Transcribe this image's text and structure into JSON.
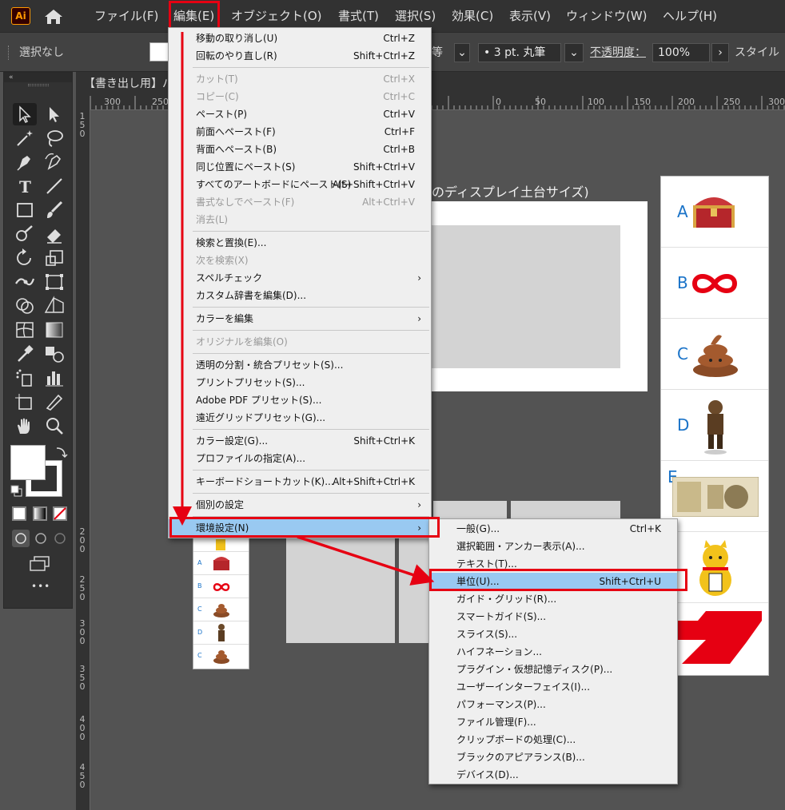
{
  "app": {
    "logo_text": "Ai"
  },
  "menubar": {
    "items": [
      "ファイル(F)",
      "編集(E)",
      "オブジェクト(O)",
      "書式(T)",
      "選択(S)",
      "効果(C)",
      "表示(V)",
      "ウィンドウ(W)",
      "ヘルプ(H)"
    ]
  },
  "controlbar": {
    "selection": "選択なし",
    "stroke_style": "等",
    "brush": "• 3 pt. 丸筆",
    "opacity_label": "不透明度：",
    "opacity_value": "100%",
    "style_label": "スタイル"
  },
  "toolbar": {
    "collapse": "«",
    "more": "•••"
  },
  "document": {
    "tab_title": "【書き出し用】パ",
    "artboard_title": "のディスプレイ土台サイズ)"
  },
  "rulers": {
    "h_ticks": [
      "300",
      "250",
      "150",
      "100",
      "50",
      "0",
      "50",
      "100",
      "150",
      "200",
      "250",
      "300"
    ],
    "v_ticks": [
      "1 5 0",
      "2 0 0",
      "2 5 0",
      "3 0 0",
      "3 5 0",
      "4 0 0",
      "4 5 0"
    ]
  },
  "stickers": {
    "letters": [
      "A",
      "B",
      "C",
      "D",
      "E"
    ],
    "mini_letters": [
      "A",
      "B",
      "C",
      "D",
      "C"
    ]
  },
  "edit_menu": {
    "items": [
      {
        "label": "移動の取り消し(U)",
        "shortcut": "Ctrl+Z"
      },
      {
        "label": "回転のやり直し(R)",
        "shortcut": "Shift+Ctrl+Z"
      },
      {
        "label": "カット(T)",
        "shortcut": "Ctrl+X",
        "disabled": true
      },
      {
        "label": "コピー(C)",
        "shortcut": "Ctrl+C",
        "disabled": true
      },
      {
        "label": "ペースト(P)",
        "shortcut": "Ctrl+V"
      },
      {
        "label": "前面へペースト(F)",
        "shortcut": "Ctrl+F"
      },
      {
        "label": "背面へペースト(B)",
        "shortcut": "Ctrl+B"
      },
      {
        "label": "同じ位置にペースト(S)",
        "shortcut": "Shift+Ctrl+V"
      },
      {
        "label": "すべてのアートボードにペースト(S)",
        "shortcut": "Alt+Shift+Ctrl+V"
      },
      {
        "label": "書式なしでペースト(F)",
        "shortcut": "Alt+Ctrl+V",
        "disabled": true
      },
      {
        "label": "消去(L)",
        "shortcut": "",
        "disabled": true
      },
      {
        "label": "検索と置換(E)...",
        "shortcut": ""
      },
      {
        "label": "次を検索(X)",
        "shortcut": "",
        "disabled": true
      },
      {
        "label": "スペルチェック",
        "shortcut": "",
        "submenu": true
      },
      {
        "label": "カスタム辞書を編集(D)...",
        "shortcut": ""
      },
      {
        "label": "カラーを編集",
        "shortcut": "",
        "submenu": true
      },
      {
        "label": "オリジナルを編集(O)",
        "shortcut": "",
        "disabled": true
      },
      {
        "label": "透明の分割・統合プリセット(S)...",
        "shortcut": ""
      },
      {
        "label": "プリントプリセット(S)...",
        "shortcut": ""
      },
      {
        "label": "Adobe PDF プリセット(S)...",
        "shortcut": ""
      },
      {
        "label": "遠近グリッドプリセット(G)...",
        "shortcut": ""
      },
      {
        "label": "カラー設定(G)...",
        "shortcut": "Shift+Ctrl+K"
      },
      {
        "label": "プロファイルの指定(A)...",
        "shortcut": ""
      },
      {
        "label": "キーボードショートカット(K)...",
        "shortcut": "Alt+Shift+Ctrl+K"
      },
      {
        "label": "個別の設定",
        "shortcut": "",
        "submenu": true
      },
      {
        "label": "環境設定(N)",
        "shortcut": "",
        "submenu": true,
        "highlighted": true
      }
    ]
  },
  "prefs_menu": {
    "items": [
      {
        "label": "一般(G)...",
        "shortcut": "Ctrl+K"
      },
      {
        "label": "選択範囲・アンカー表示(A)...",
        "shortcut": ""
      },
      {
        "label": "テキスト(T)...",
        "shortcut": ""
      },
      {
        "label": "単位(U)...",
        "shortcut": "Shift+Ctrl+U",
        "highlighted": true
      },
      {
        "label": "ガイド・グリッド(R)...",
        "shortcut": ""
      },
      {
        "label": "スマートガイド(S)...",
        "shortcut": ""
      },
      {
        "label": "スライス(S)...",
        "shortcut": ""
      },
      {
        "label": "ハイフネーション...",
        "shortcut": ""
      },
      {
        "label": "プラグイン・仮想記憶ディスク(P)...",
        "shortcut": ""
      },
      {
        "label": "ユーザーインターフェイス(I)...",
        "shortcut": ""
      },
      {
        "label": "パフォーマンス(P)...",
        "shortcut": ""
      },
      {
        "label": "ファイル管理(F)...",
        "shortcut": ""
      },
      {
        "label": "クリップボードの処理(C)...",
        "shortcut": ""
      },
      {
        "label": "ブラックのアピアランス(B)...",
        "shortcut": ""
      },
      {
        "label": "デバイス(D)...",
        "shortcut": ""
      }
    ]
  },
  "colors": {
    "annotation_red": "#e60012",
    "highlight": "#99c9f1"
  }
}
